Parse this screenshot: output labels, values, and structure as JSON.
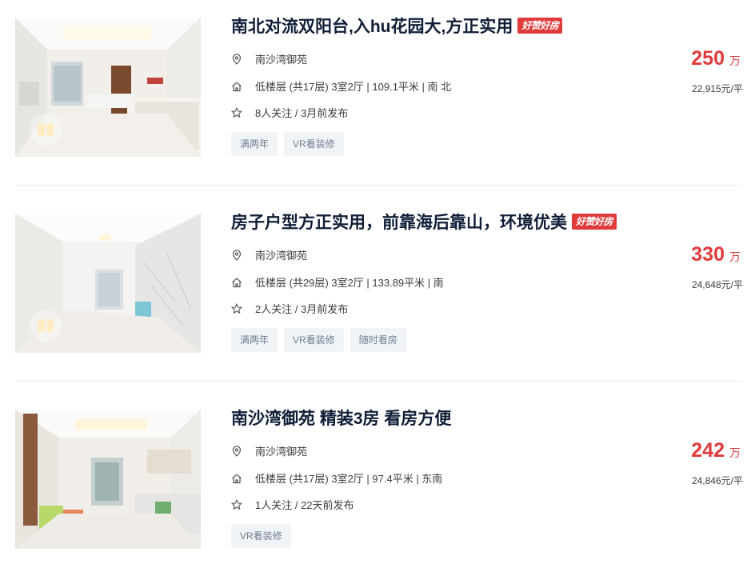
{
  "listings": [
    {
      "title": "南北对流双阳台,入hu花园大,方正实用",
      "badge": "好赞好房",
      "community": "南沙湾御苑",
      "house_info": "低楼层 (共17层) 3室2厅 | 109.1平米 | 南 北",
      "follow_info": "8人关注 / 3月前发布",
      "tags": [
        "满两年",
        "VR看装修"
      ],
      "total_price": "250",
      "price_unit": "万",
      "unit_price": "22,915元/平"
    },
    {
      "title": "房子户型方正实用，前靠海后靠山，环境优美",
      "badge": "好赞好房",
      "community": "南沙湾御苑",
      "house_info": "低楼层 (共29层) 3室2厅 | 133.89平米 | 南",
      "follow_info": "2人关注 / 3月前发布",
      "tags": [
        "满两年",
        "VR看装修",
        "随时看房"
      ],
      "total_price": "330",
      "price_unit": "万",
      "unit_price": "24,648元/平"
    },
    {
      "title": "南沙湾御苑 精装3房 看房方便",
      "badge": "",
      "community": "南沙湾御苑",
      "house_info": "低楼层 (共17层) 3室2厅 | 97.4平米 | 东南",
      "follow_info": "1人关注 / 22天前发布",
      "tags": [
        "VR看装修"
      ],
      "total_price": "242",
      "price_unit": "万",
      "unit_price": "24,846元/平"
    }
  ],
  "icons": {
    "location": "location-pin-icon",
    "house": "house-icon",
    "follow": "star-icon"
  },
  "colors": {
    "title": "#101d37",
    "price": "#e03a3a",
    "badge_bg": "#e03a3a",
    "tag_bg": "#f1f4f7",
    "tag_text": "#6f7e90"
  }
}
